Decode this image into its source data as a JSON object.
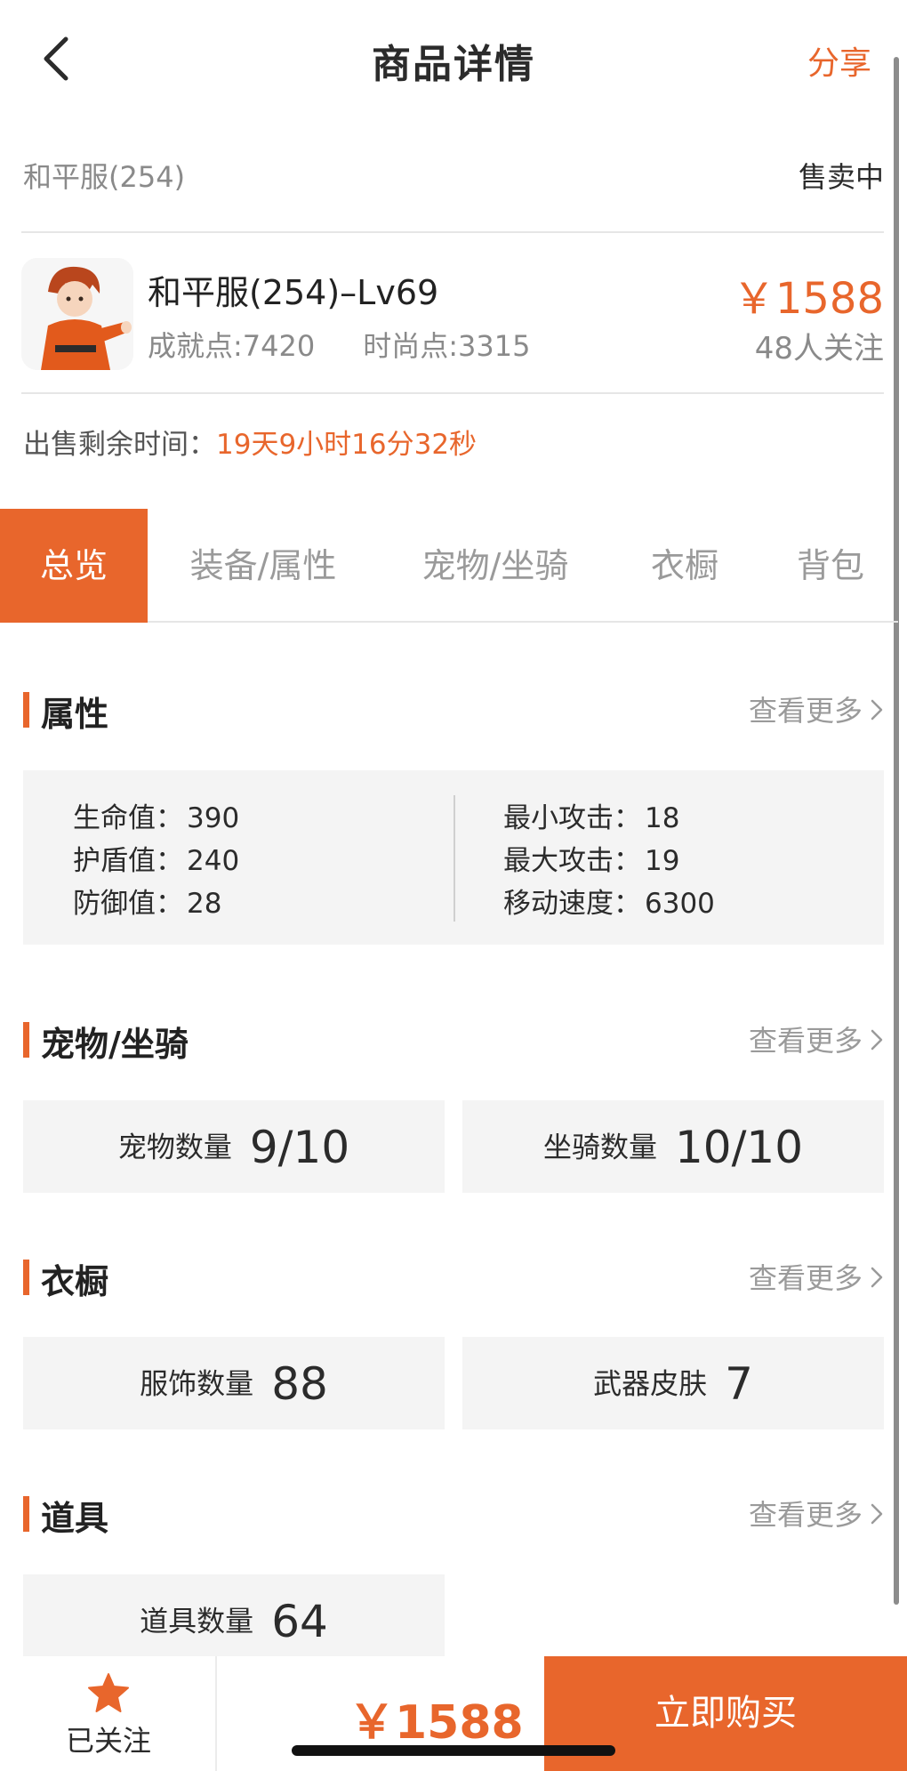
{
  "header": {
    "title": "商品详情",
    "share_label": "分享"
  },
  "listing": {
    "server_name": "和平服(254)",
    "status": "售卖中",
    "product_title": "和平服(254)–Lv69",
    "achievement": "成就点:7420",
    "fashion": "时尚点:3315",
    "price": "￥1588",
    "followers": "48人关注",
    "remaining_label": "出售剩余时间：",
    "remaining_value": "19天9小时16分32秒"
  },
  "tabs": [
    "总览",
    "装备/属性",
    "宠物/坐骑",
    "衣橱",
    "背包"
  ],
  "active_tab_index": 0,
  "sections": {
    "more_label": "查看更多",
    "attributes": {
      "title": "属性",
      "left": [
        {
          "label": "生命值：",
          "value": "390"
        },
        {
          "label": "护盾值：",
          "value": "240"
        },
        {
          "label": "防御值：",
          "value": "28"
        }
      ],
      "right": [
        {
          "label": "最小攻击：",
          "value": "18"
        },
        {
          "label": "最大攻击：",
          "value": "19"
        },
        {
          "label": "移动速度：",
          "value": "6300"
        }
      ]
    },
    "pets": {
      "title": "宠物/坐骑",
      "cards": [
        {
          "label": "宠物数量",
          "value": "9/10"
        },
        {
          "label": "坐骑数量",
          "value": "10/10"
        }
      ]
    },
    "wardrobe": {
      "title": "衣橱",
      "cards": [
        {
          "label": "服饰数量",
          "value": "88"
        },
        {
          "label": "武器皮肤",
          "value": "7"
        }
      ]
    },
    "items": {
      "title": "道具",
      "cards": [
        {
          "label": "道具数量",
          "value": "64"
        }
      ]
    }
  },
  "bottom_bar": {
    "follow_label": "已关注",
    "price": "￥1588",
    "buy_label": "立即购买"
  },
  "colors": {
    "accent": "#e8662c",
    "text": "#222222",
    "muted": "#8a8a8a",
    "panel": "#f4f4f4"
  },
  "icons": {
    "back": "chevron-left-icon",
    "more": "chevron-right-icon",
    "follow": "star-icon"
  }
}
